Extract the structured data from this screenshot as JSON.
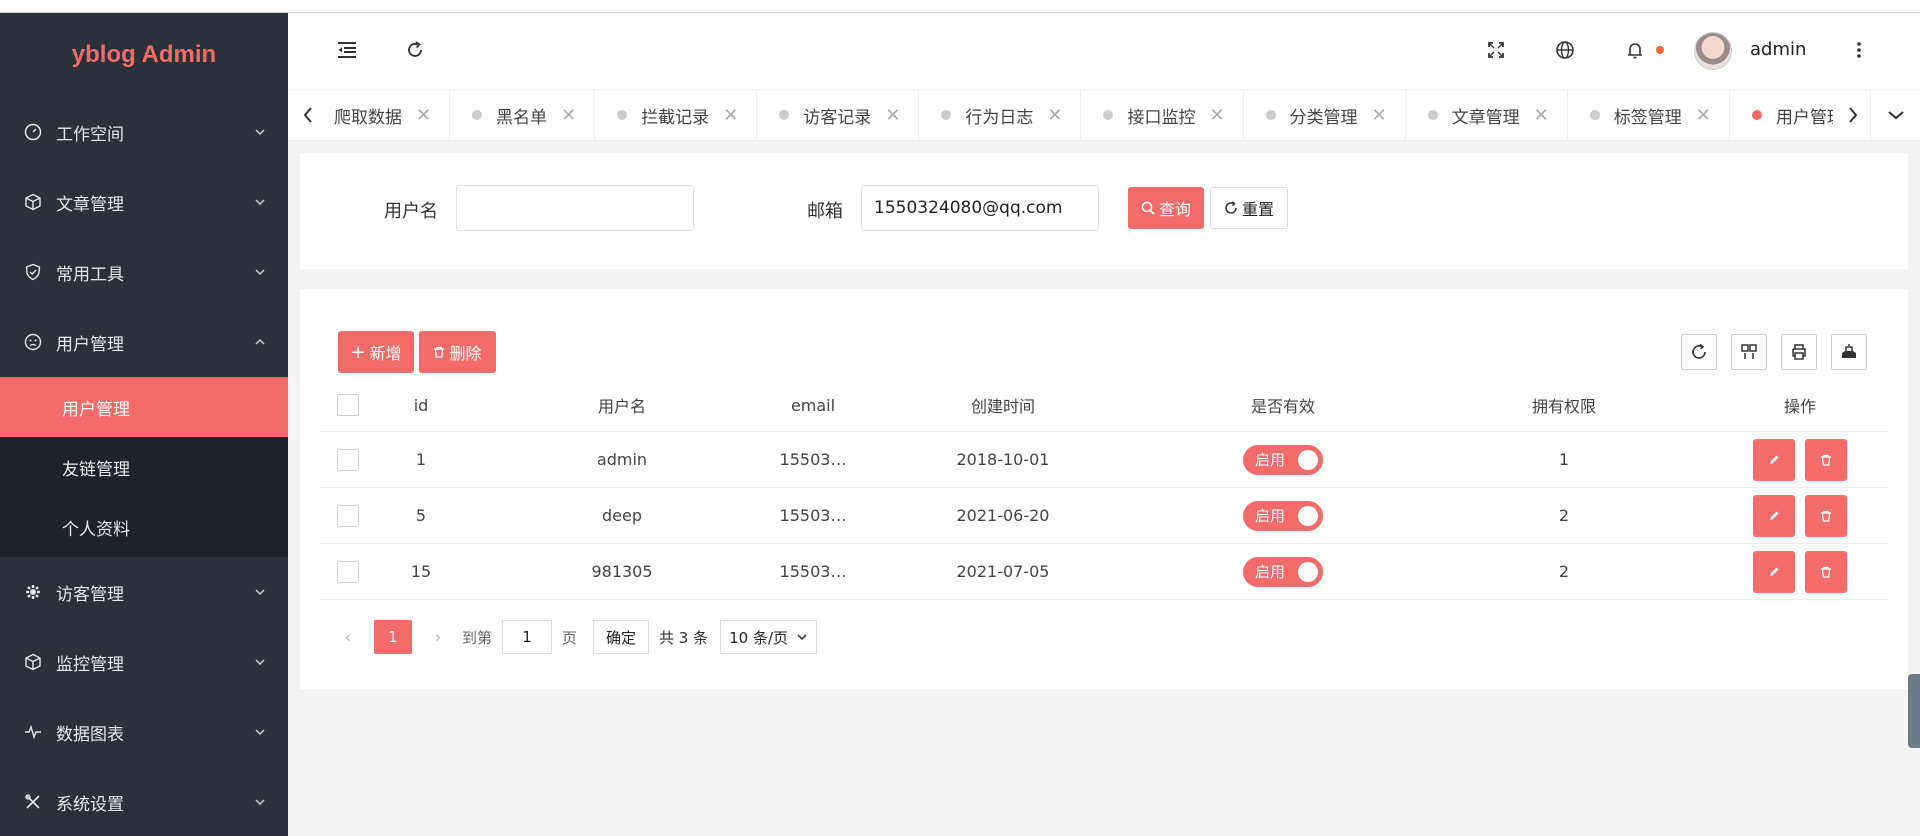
{
  "app": {
    "title": "yblog Admin"
  },
  "sidebar": {
    "items": [
      {
        "label": "工作空间",
        "icon": "dashboard-icon"
      },
      {
        "label": "文章管理",
        "icon": "cube-icon"
      },
      {
        "label": "常用工具",
        "icon": "shield-icon"
      },
      {
        "label": "用户管理",
        "icon": "face-icon",
        "expanded": true,
        "children": [
          {
            "label": "用户管理",
            "active": true
          },
          {
            "label": "友链管理"
          },
          {
            "label": "个人资料"
          }
        ]
      },
      {
        "label": "访客管理",
        "icon": "gear-icon"
      },
      {
        "label": "监控管理",
        "icon": "cube-icon"
      },
      {
        "label": "数据图表",
        "icon": "pulse-icon"
      },
      {
        "label": "系统设置",
        "icon": "tools-icon"
      }
    ]
  },
  "header": {
    "username": "admin",
    "icons": [
      "menu-fold-icon",
      "refresh-icon",
      "fullscreen-icon",
      "globe-icon",
      "bell-icon",
      "more-icon"
    ]
  },
  "tabs": [
    {
      "label": "爬取数据"
    },
    {
      "label": "黑名单"
    },
    {
      "label": "拦截记录"
    },
    {
      "label": "访客记录"
    },
    {
      "label": "行为日志"
    },
    {
      "label": "接口监控"
    },
    {
      "label": "分类管理"
    },
    {
      "label": "文章管理"
    },
    {
      "label": "标签管理"
    },
    {
      "label": "用户管理",
      "active": true
    }
  ],
  "search": {
    "username_label": "用户名",
    "username_value": "",
    "email_label": "邮箱",
    "email_value": "1550324080@qq.com",
    "query_label": "查询",
    "reset_label": "重置"
  },
  "toolbar": {
    "add_label": "新增",
    "delete_label": "删除"
  },
  "table": {
    "columns": [
      "id",
      "用户名",
      "email",
      "创建时间",
      "是否有效",
      "拥有权限",
      "操作"
    ],
    "rows": [
      {
        "id": "1",
        "username": "admin",
        "email": "15503…",
        "created": "2018-10-01",
        "valid": "启用",
        "perm": "1"
      },
      {
        "id": "5",
        "username": "deep",
        "email": "15503…",
        "created": "2021-06-20",
        "valid": "启用",
        "perm": "2"
      },
      {
        "id": "15",
        "username": "981305",
        "email": "15503…",
        "created": "2021-07-05",
        "valid": "启用",
        "perm": "2"
      }
    ]
  },
  "pager": {
    "current": "1",
    "goto_label": "到第",
    "goto_value": "1",
    "page_unit": "页",
    "confirm_label": "确定",
    "total_label": "共 3 条",
    "page_size": "10 条/页"
  },
  "colors": {
    "accent": "#f36b6b",
    "sidebar": "#2b3139",
    "submenu": "#1f242b"
  }
}
